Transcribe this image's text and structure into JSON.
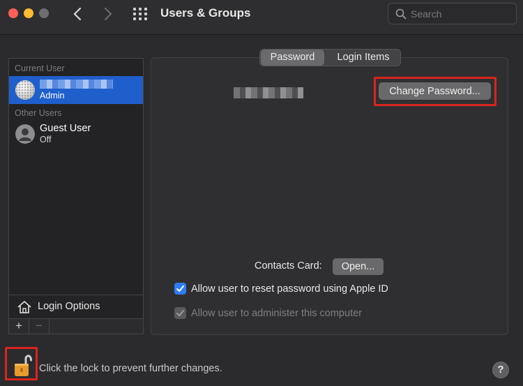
{
  "window": {
    "title": "Users & Groups"
  },
  "search": {
    "placeholder": "Search",
    "value": ""
  },
  "sidebar": {
    "current_user_label": "Current User",
    "other_users_label": "Other Users",
    "users": [
      {
        "name": "",
        "role": "Admin",
        "selected": true,
        "avatar": "golf-ball-avatar"
      },
      {
        "name": "Guest User",
        "role": "Off",
        "selected": false,
        "avatar": "person-silhouette-avatar"
      }
    ],
    "login_options_label": "Login Options",
    "add_label": "+",
    "remove_label": "−"
  },
  "tabs": [
    {
      "label": "Password",
      "selected": true
    },
    {
      "label": "Login Items",
      "selected": false
    }
  ],
  "main": {
    "change_password_label": "Change Password...",
    "contacts_card_label": "Contacts Card:",
    "open_label": "Open...",
    "allow_reset_label": "Allow user to reset password using Apple ID",
    "allow_reset_checked": true,
    "allow_admin_label": "Allow user to administer this computer",
    "allow_admin_checked": true,
    "allow_admin_disabled": true
  },
  "footer": {
    "lock_text": "Click the lock to prevent further changes.",
    "help_label": "?"
  },
  "colors": {
    "accent": "#1f5fcc",
    "checkbox": "#2f7df6",
    "highlight": "#d9251c",
    "lock": "#e89a2c"
  }
}
